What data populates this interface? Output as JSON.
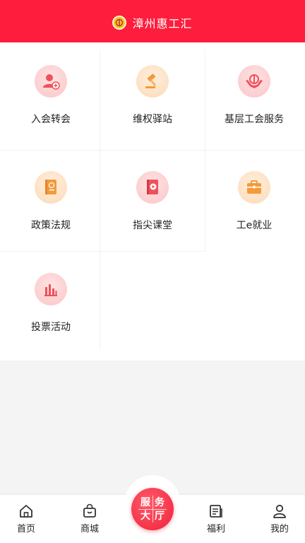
{
  "header": {
    "title": "漳州惠工汇"
  },
  "services": [
    {
      "label": "入会转会",
      "icon": "user-add-icon"
    },
    {
      "label": "维权驿站",
      "icon": "gavel-icon"
    },
    {
      "label": "基层工会服务",
      "icon": "hands-union-icon"
    },
    {
      "label": "政策法规",
      "icon": "book-icon"
    },
    {
      "label": "指尖课堂",
      "icon": "video-book-icon"
    },
    {
      "label": "工e就业",
      "icon": "briefcase-icon"
    },
    {
      "label": "投票活动",
      "icon": "bar-chart-icon"
    }
  ],
  "tabbar": {
    "home": "首页",
    "mall": "商城",
    "service_hall": [
      "服",
      "务",
      "大",
      "厅"
    ],
    "welfare": "福利",
    "mine": "我的"
  },
  "colors": {
    "brand": "#fe1d3c",
    "pink_icon": "#f0505a",
    "orange_icon": "#f49a3a"
  }
}
